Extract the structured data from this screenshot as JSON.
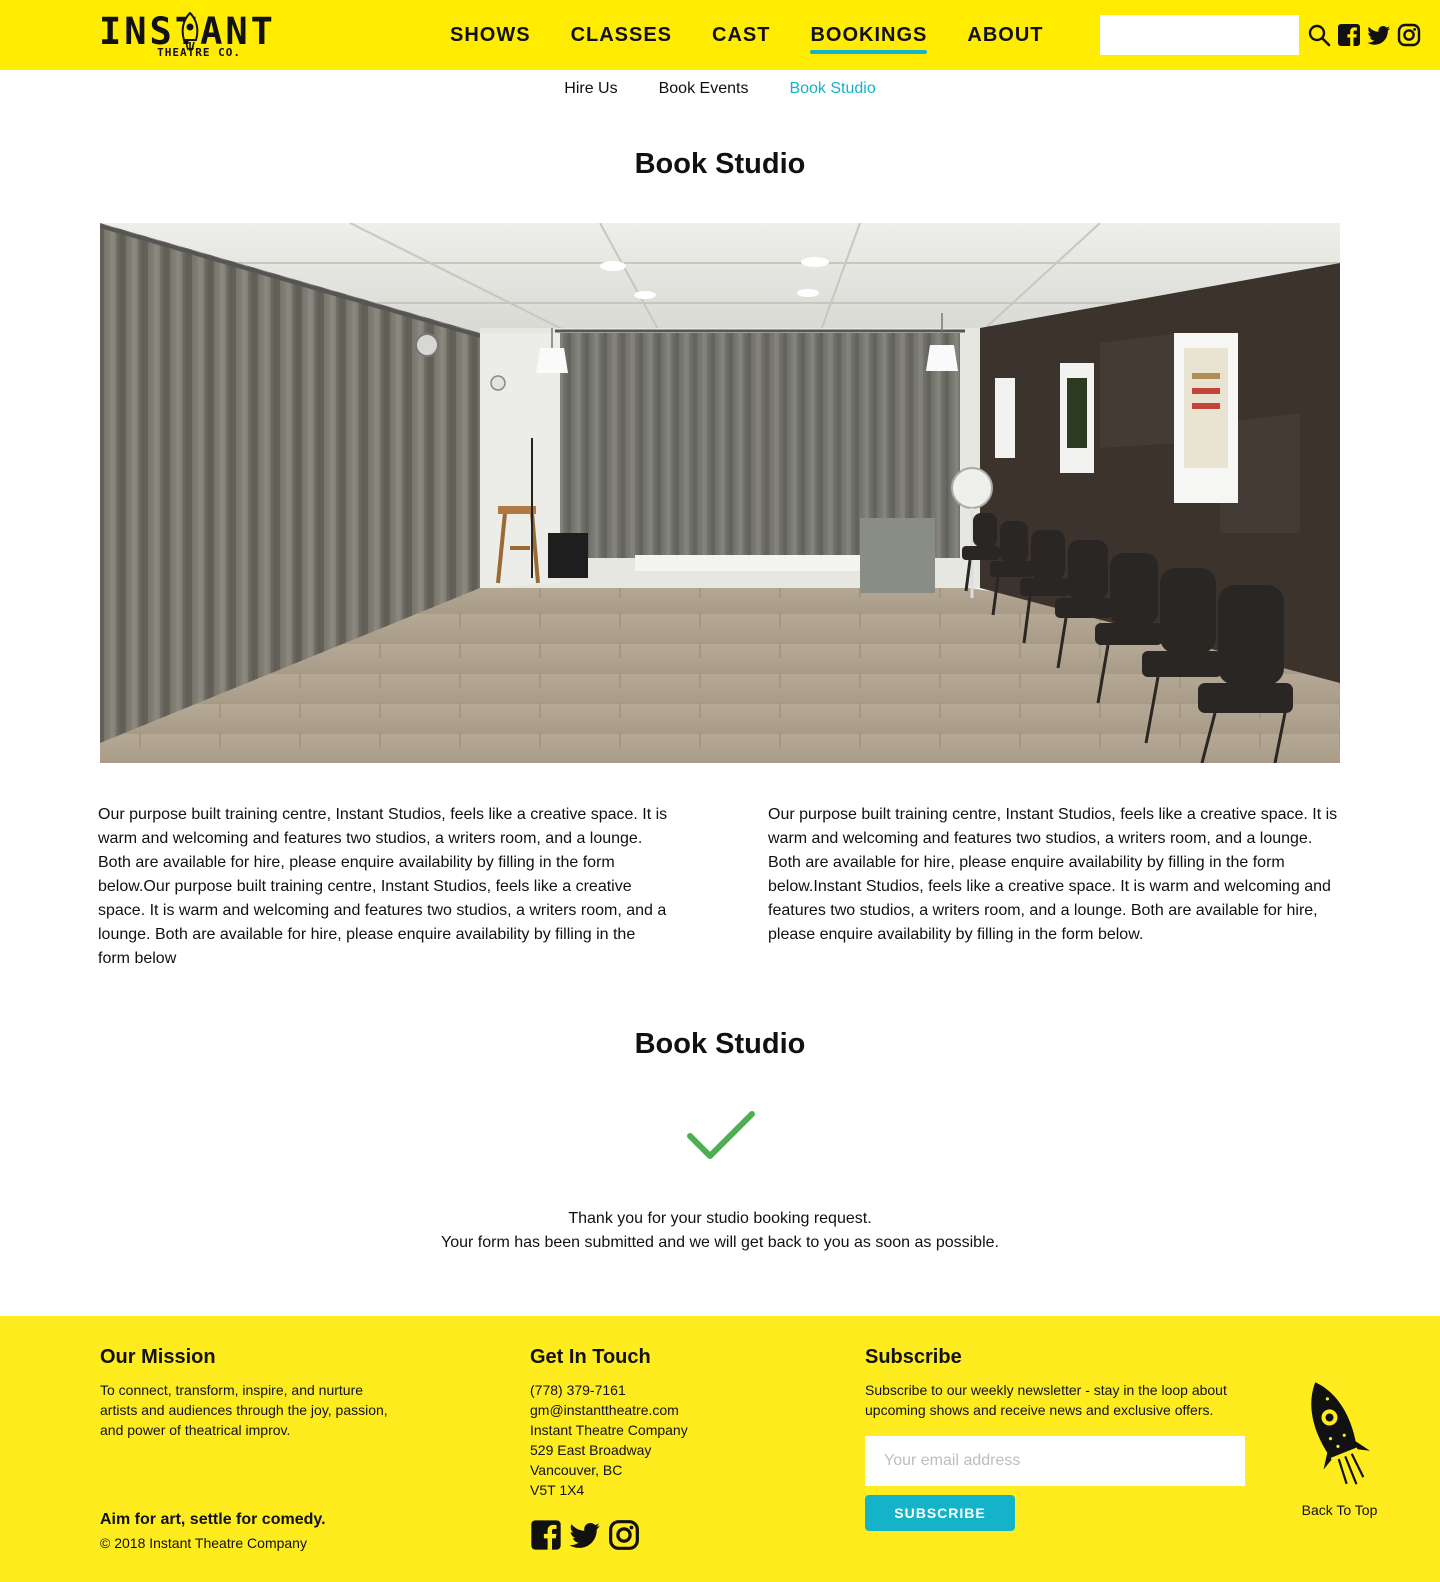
{
  "header": {
    "logo_main": "INSTANT",
    "logo_sub": "THEATRE CO.",
    "nav": [
      {
        "label": "SHOWS"
      },
      {
        "label": "CLASSES"
      },
      {
        "label": "CAST"
      },
      {
        "label": "BOOKINGS",
        "active": true
      },
      {
        "label": "ABOUT"
      }
    ],
    "search": {
      "value": "",
      "placeholder": ""
    },
    "icons": [
      "search-icon",
      "facebook-icon",
      "twitter-icon",
      "instagram-icon"
    ]
  },
  "subnav": [
    {
      "label": "Hire Us"
    },
    {
      "label": "Book Events"
    },
    {
      "label": "Book Studio",
      "active": true
    }
  ],
  "page": {
    "title": "Book Studio",
    "photo_subject": "Empty studio with grey curtains, wood floor and row of folding chairs",
    "left_paragraph": "Our purpose built training centre, Instant Studios, feels like a creative space. It is warm and welcoming and features two studios, a writers room, and a lounge. Both are available for hire, please enquire availability by filling in the form below.Our purpose built training centre, Instant Studios, feels like a creative space. It is warm and welcoming and features two studios, a writers room, and a lounge. Both are available for hire, please enquire availability by filling in the form below",
    "right_paragraph": "Our purpose built training centre, Instant Studios, feels like a creative space. It is warm and welcoming and features two studios, a writers room, and a lounge. Both are available for hire, please enquire availability by filling in the form below.Instant Studios, feels like a creative space. It is warm and welcoming and features two studios, a writers room, and a lounge. Both are available for hire, please enquire availability by filling in the form below.",
    "form_title": "Book Studio",
    "success_icon": "checkmark-icon",
    "thanks_line1": "Thank you for your studio booking request.",
    "thanks_line2": "Your form has been submitted and we will get back to you as soon as possible."
  },
  "footer": {
    "mission_title": "Our Mission",
    "mission_text": "To connect, transform, inspire, and nurture artists and audiences through the joy, passion, and power of theatrical improv.",
    "tagline": "Aim for art, settle for comedy.",
    "copyright": "© 2018 Instant Theatre Company",
    "contact_title": "Get In Touch",
    "contact_lines": [
      "(778) 379-7161",
      "gm@instanttheatre.com",
      "Instant Theatre Company",
      "529 East Broadway",
      "Vancouver, BC",
      "V5T 1X4"
    ],
    "social_icons": [
      "facebook-icon",
      "twitter-icon",
      "instagram-icon"
    ],
    "subscribe_title": "Subscribe",
    "subscribe_text": "Subscribe to our weekly newsletter - stay in the loop about upcoming shows and receive news and exclusive offers.",
    "email_placeholder": "Your email address",
    "email_value": "",
    "subscribe_button": "SUBSCRIBE",
    "back_to_top": "Back To Top"
  },
  "colors": {
    "brand_yellow": "#ffec00",
    "footer_yellow": "#ffec1f",
    "accent_teal": "#14b3c9",
    "success_green": "#4caf50",
    "text": "#111111"
  }
}
